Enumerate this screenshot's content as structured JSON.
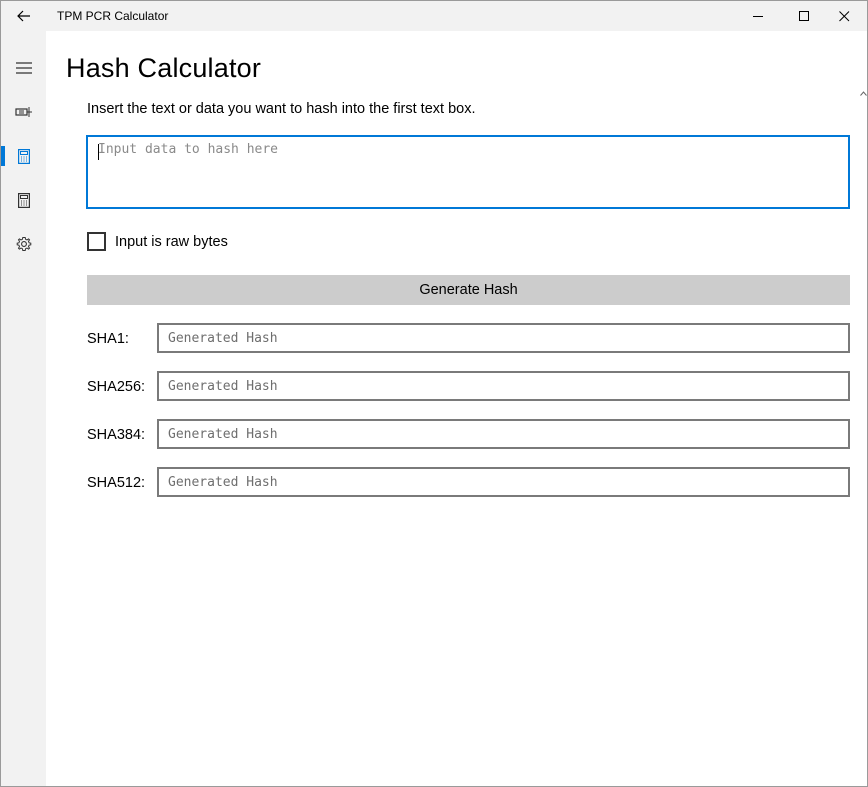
{
  "window": {
    "title": "TPM PCR Calculator"
  },
  "nav": {
    "items": [
      {
        "icon": "hamburger-menu-icon"
      },
      {
        "icon": "tpm-chip-icon"
      },
      {
        "icon": "hash-calculator-icon",
        "selected": true
      },
      {
        "icon": "pcr-calculator-icon"
      },
      {
        "icon": "settings-gear-icon"
      }
    ],
    "accent_color": "#0078d7"
  },
  "page": {
    "title": "Hash Calculator",
    "instructions": "Insert the text or data you want to hash into the first text box.",
    "input_placeholder": "Input data to hash here",
    "raw_bytes_label": "Input is raw bytes",
    "raw_bytes_checked": false,
    "generate_button": "Generate Hash",
    "hashes": [
      {
        "label": "SHA1:",
        "placeholder": "Generated Hash"
      },
      {
        "label": "SHA256:",
        "placeholder": "Generated Hash"
      },
      {
        "label": "SHA384:",
        "placeholder": "Generated Hash"
      },
      {
        "label": "SHA512:",
        "placeholder": "Generated Hash"
      }
    ]
  }
}
